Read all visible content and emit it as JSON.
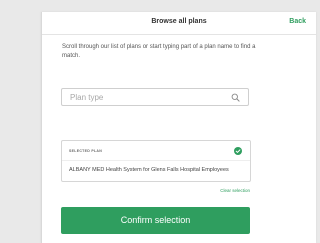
{
  "header": {
    "title": "Browse all plans",
    "back_label": "Back"
  },
  "instructions": "Scroll through our list of plans or start typing part of a plan name to find a match.",
  "search": {
    "placeholder": "Plan type",
    "value": "",
    "icon": "search-icon"
  },
  "selection": {
    "label": "SELECTED PLAN",
    "plan_name": "ALBANY MED Health System for Glens Falls Hospital Employees",
    "status_icon": "check-circle-icon",
    "clear_label": "Clear selection"
  },
  "confirm_label": "Confirm selection",
  "colors": {
    "accent": "#2f9e5f",
    "background": "#e9e9e9",
    "card": "#ffffff"
  }
}
